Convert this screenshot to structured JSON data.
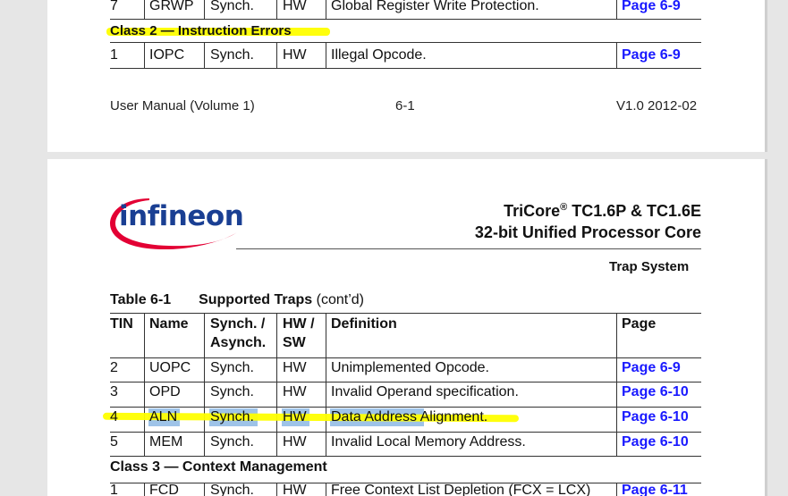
{
  "page1": {
    "row7": {
      "tin": "7",
      "name": "GRWP",
      "sync": "Synch.",
      "hw": "HW",
      "def": "Global Register Write Protection.",
      "page": "Page 6-9"
    },
    "class2_header": "Class 2 — Instruction Errors",
    "row1": {
      "tin": "1",
      "name": "IOPC",
      "sync": "Synch.",
      "hw": "HW",
      "def": "Illegal Opcode.",
      "page": "Page 6-9"
    },
    "footer": {
      "left": "User Manual (Volume 1)",
      "center": "6-1",
      "right": "V1.0 2012-02"
    }
  },
  "page2": {
    "logo_text": "infineon",
    "title_line1_prefix": "TriCore",
    "title_reg": "®",
    "title_line1_suffix": " TC1.6P & TC1.6E",
    "title_line2": "32-bit Unified Processor Core",
    "section": "Trap System",
    "table_label": "Table 6-1",
    "table_title": "Supported Traps",
    "table_cont": " (cont’d)",
    "headers": {
      "tin": "TIN",
      "name": "Name",
      "sync1": "Synch. /",
      "sync2": "Asynch.",
      "hw1": "HW /",
      "hw2": "SW",
      "def": "Definition",
      "page": "Page"
    },
    "rows": [
      {
        "tin": "2",
        "name": "UOPC",
        "sync": "Synch.",
        "hw": "HW",
        "def": "Unimplemented Opcode.",
        "page": "Page 6-9"
      },
      {
        "tin": "3",
        "name": "OPD",
        "sync": "Synch.",
        "hw": "HW",
        "def": "Invalid Operand specification.",
        "page": "Page 6-10"
      },
      {
        "tin": "4",
        "name": "ALN",
        "sync": "Synch.",
        "hw": "HW",
        "def": "Data Address Alignment.",
        "page": "Page 6-10"
      },
      {
        "tin": "5",
        "name": "MEM",
        "sync": "Synch.",
        "hw": "HW",
        "def": "Invalid Local Memory Address.",
        "page": "Page 6-10"
      }
    ],
    "class3_header": "Class 3 — Context Management",
    "row_class3": {
      "tin": "1",
      "name": "FCD",
      "sync": "Synch.",
      "hw": "HW",
      "def": "Free Context List Depletion (FCX = LCX)",
      "page": "Page 6-11"
    }
  },
  "colors": {
    "highlight": "#ffff00",
    "selection": "#9ec3e8",
    "link": "#1a1aff",
    "logo_red": "#e30034",
    "logo_blue": "#1a3f93"
  }
}
